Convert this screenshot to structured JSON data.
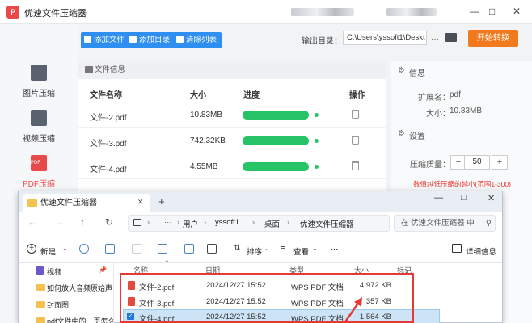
{
  "app": {
    "logo_text": "P",
    "title": "优速文件压缩器",
    "window_controls": [
      "—",
      "□",
      "✕"
    ]
  },
  "sidebar": {
    "items": [
      {
        "label": "图片压缩",
        "icon": "image-icon"
      },
      {
        "label": "视频压缩",
        "icon": "video-icon"
      },
      {
        "label": "PDF压缩",
        "icon": "pdf-icon",
        "active": true
      }
    ]
  },
  "toolbar": {
    "add_file": "添加文件",
    "add_folder": "添加目录",
    "clear_list": "清除列表",
    "output_label": "输出目录：",
    "output_path": "C:\\Users\\yssoft1\\Deskt",
    "start": "开始转换"
  },
  "file_panel": {
    "header": "文件信息",
    "columns": [
      "文件名称",
      "大小",
      "进度",
      "操作"
    ],
    "rows": [
      {
        "name": "文件-2.pdf",
        "size": "10.83MB",
        "progress": 1.0
      },
      {
        "name": "文件-3.pdf",
        "size": "742.32KB",
        "progress": 1.0
      },
      {
        "name": "文件-4.pdf",
        "size": "4.55MB",
        "progress": 1.0
      }
    ]
  },
  "info_panel": {
    "header": "信息",
    "ext_label": "扩展名：",
    "ext_value": "pdf",
    "size_label": "大小：",
    "size_value": "10.83MB",
    "settings_header": "设置",
    "quality_label": "压缩质量：",
    "quality_minus": "−",
    "quality_value": "50",
    "quality_plus": "+",
    "hint": "数值越低压缩的越小(范围1-300)"
  },
  "explorer": {
    "tab_title": "优速文件压缩器",
    "tab_close": "✕",
    "new_tab": "+",
    "window_controls": [
      "—",
      "□",
      "✕"
    ],
    "nav": {
      "back": "←",
      "forward": "→",
      "up": "↑",
      "refresh": "↻"
    },
    "breadcrumb": [
      "用户",
      "yssoft1",
      "桌面",
      "优速文件压缩器"
    ],
    "search_placeholder": "在 优速文件压缩器 中",
    "commands": {
      "new": "新建",
      "sort": "排序",
      "view": "查看",
      "more": "···",
      "details": "详细信息"
    },
    "nav_pane": [
      "视频",
      "如何放大音频原始声音",
      "封面图",
      "pdf文件中的一页怎么"
    ],
    "columns": [
      "名称",
      "日期",
      "类型",
      "大小",
      "标记"
    ],
    "files": [
      {
        "name": "文件-2.pdf",
        "date": "2024/12/27 15:52",
        "type": "WPS PDF 文档",
        "size": "4,972 KB"
      },
      {
        "name": "文件-3.pdf",
        "date": "2024/12/27 15:52",
        "type": "WPS PDF 文档",
        "size": "357 KB"
      },
      {
        "name": "文件-4.pdf",
        "date": "2024/12/27 15:52",
        "type": "WPS PDF 文档",
        "size": "1,564 KB",
        "selected": true
      }
    ]
  },
  "colors": {
    "accent": "#2e8ff0",
    "start": "#f07a1d",
    "progress": "#27c467",
    "highlight_box": "#e53935"
  }
}
